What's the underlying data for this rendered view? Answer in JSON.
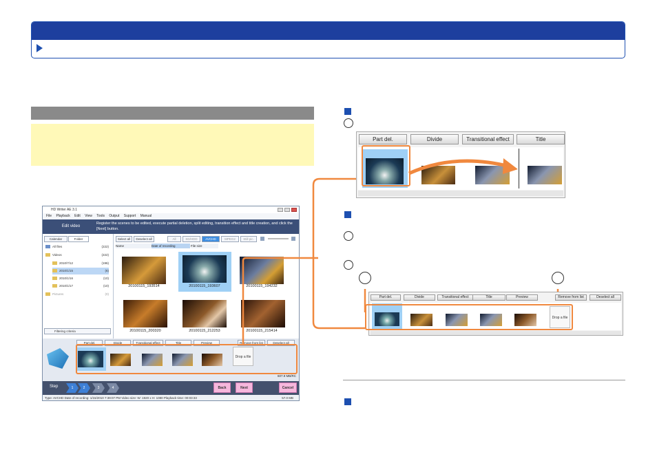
{
  "win": {
    "title": "HD Writer AE 3.1",
    "menu": [
      "File",
      "Playback",
      "Edit",
      "View",
      "Tools",
      "Output",
      "Support",
      "Manual"
    ],
    "banner_title": "Edit video",
    "banner_text": "Register the scenes to be edited, execute partial deletion, split editing, transition effect and title creation, and click the [Next] button.",
    "tabs": [
      "Calendar",
      "Folder"
    ],
    "tree": [
      {
        "label": "All files",
        "count": "(222)"
      },
      {
        "label": "Videos",
        "count": "(222)"
      },
      {
        "label": "2010/7/12",
        "count": "(196)"
      },
      {
        "label": "2010/1/15",
        "count": "(6)"
      },
      {
        "label": "2010/1/16",
        "count": "(10)"
      },
      {
        "label": "2010/1/17",
        "count": "(10)"
      },
      {
        "label": "Pictures",
        "count": "(0)"
      }
    ],
    "filter_label": "Filtering criteria",
    "toolbar": [
      "Select all",
      "Deselect all",
      "All",
      "SD/HDD",
      "AVCHD",
      "MPEG2",
      "Still pic."
    ],
    "sort": [
      "Name",
      "Date of recording",
      "File size"
    ],
    "captions": [
      "20100115_193514",
      "20100115_193607",
      "20100115_194232",
      "20100115_200320",
      "20100115_212253",
      "20100115_215414"
    ],
    "story_buttons": [
      "Part del.",
      "Divide",
      "Transitional effect",
      "Title",
      "Preview",
      "Remove from list",
      "Deselect all"
    ],
    "drop_label": "Drop a file",
    "size_text": "607.9 MB/RC",
    "step_label": "Step",
    "steps": [
      "1",
      "2",
      "3",
      "4"
    ],
    "back": "Back",
    "next": "Next",
    "cancel": "Cancel",
    "status": "Type: AVCHD  Date of recording: 1/15/2010 7:39:07 PM  Video size: W: 1920 x H: 1080 Playback time: 00:03:33",
    "status_size": "57.0 MB"
  },
  "panel1": {
    "buttons": [
      "Part del.",
      "Divide",
      "Transitional effect",
      "Title"
    ]
  },
  "panel2": {
    "buttons": [
      "Part del.",
      "Divide",
      "Transitional effect",
      "Title",
      "Preview",
      "Remove from list",
      "Deselect all"
    ],
    "drop_label": "Drop a file"
  },
  "colors": {
    "accent": "#1d4fb0",
    "highlight": "#f0883e"
  }
}
